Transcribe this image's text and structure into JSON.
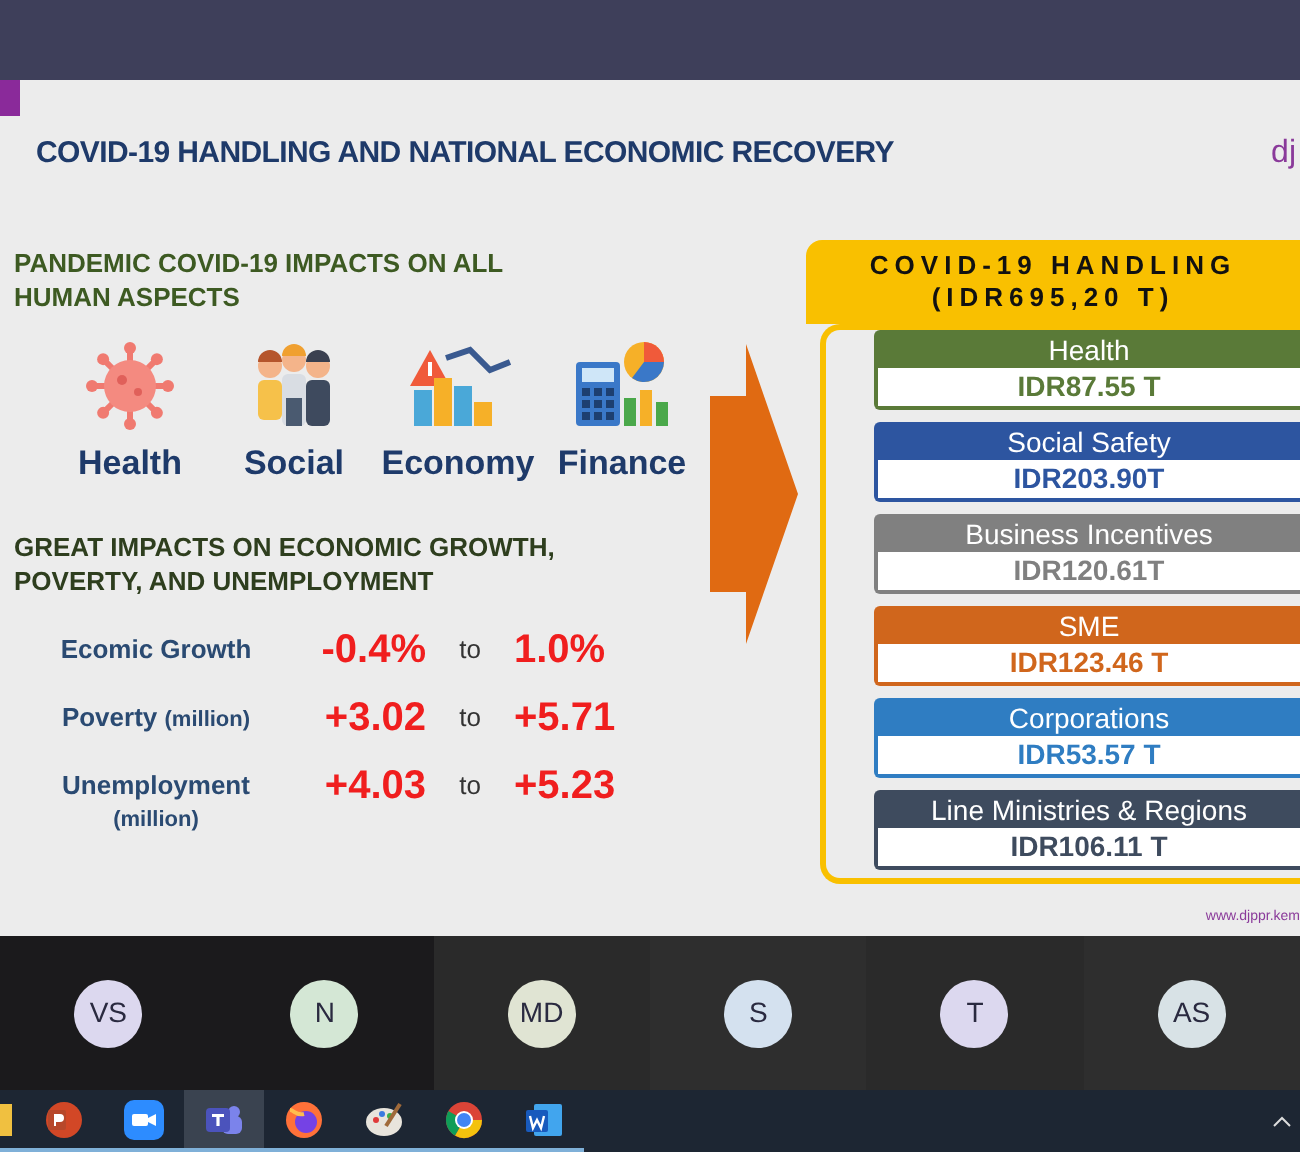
{
  "slide": {
    "title": "COVID-19 HANDLING AND NATIONAL ECONOMIC RECOVERY",
    "logo_text": "dj",
    "impacts_heading": "PANDEMIC COVID-19 IMPACTS ON ALL HUMAN ASPECTS",
    "aspects": [
      {
        "kind": "virus",
        "label": "Health"
      },
      {
        "kind": "people",
        "label": "Social"
      },
      {
        "kind": "chart",
        "label": "Economy"
      },
      {
        "kind": "calculator",
        "label": "Finance"
      }
    ],
    "growth_heading": "GREAT IMPACTS ON ECONOMIC GROWTH, POVERTY, AND UNEMPLOYMENT",
    "metrics": [
      {
        "label": "Ecomic Growth",
        "from": "-0.4%",
        "to_word": "to",
        "to": "1.0%"
      },
      {
        "label": "Poverty",
        "unit": "(million)",
        "unit_below": false,
        "from": "+3.02",
        "to_word": "to",
        "to": "+5.71"
      },
      {
        "label": "Unemployment",
        "unit": "(million)",
        "unit_below": true,
        "from": "+4.03",
        "to_word": "to",
        "to": "+5.23"
      }
    ],
    "handling": {
      "title": "COVID-19 HANDLING",
      "total": "(IDR695,20 T)",
      "items": [
        {
          "name": "Health",
          "amount": "IDR87.55 T",
          "color": "#5a7a38"
        },
        {
          "name": "Social Safety",
          "amount": "IDR203.90T",
          "color": "#2d55a0"
        },
        {
          "name": "Business Incentives",
          "amount": "IDR120.61T",
          "color": "#808080"
        },
        {
          "name": "SME",
          "amount": "IDR123.46 T",
          "color": "#d0661c"
        },
        {
          "name": "Corporations",
          "amount": "IDR53.57 T",
          "color": "#2f7dc2"
        },
        {
          "name": "Line Ministries & Regions",
          "amount": "IDR106.11 T",
          "color": "#3e4b5e"
        }
      ]
    },
    "footer_url": "www.djppr.kem"
  },
  "participants": [
    {
      "initials": "VS",
      "color": "#dcd8ef"
    },
    {
      "initials": "N",
      "color": "#d4e7d5"
    },
    {
      "initials": "MD",
      "color": "#e0e4d3"
    },
    {
      "initials": "S",
      "color": "#d4e1ef"
    },
    {
      "initials": "T",
      "color": "#dcd8ef"
    },
    {
      "initials": "AS",
      "color": "#d8e2e6"
    }
  ],
  "taskbar": {
    "apps": [
      {
        "kind": "folder",
        "selected": false
      },
      {
        "kind": "slides",
        "selected": false
      },
      {
        "kind": "video",
        "selected": false
      },
      {
        "kind": "team",
        "selected": true
      },
      {
        "kind": "browser-fox",
        "selected": false
      },
      {
        "kind": "paint",
        "selected": false
      },
      {
        "kind": "browser-round",
        "selected": false
      },
      {
        "kind": "document",
        "selected": false
      }
    ]
  }
}
